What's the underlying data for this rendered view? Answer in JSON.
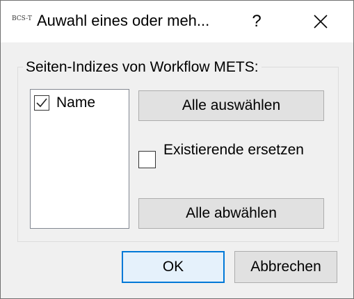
{
  "window": {
    "app_icon_text": "BCS-T",
    "title": "Auwahl eines oder meh...",
    "help_label": "?"
  },
  "group": {
    "label": "Seiten-Indizes von Workflow METS:"
  },
  "list": {
    "items": [
      {
        "label": "Name",
        "checked": true
      }
    ]
  },
  "buttons": {
    "select_all": "Alle auswählen",
    "deselect_all": "Alle abwählen",
    "ok": "OK",
    "cancel": "Abbrechen"
  },
  "replace_option": {
    "label": "Existierende ersetzen",
    "checked": false
  }
}
